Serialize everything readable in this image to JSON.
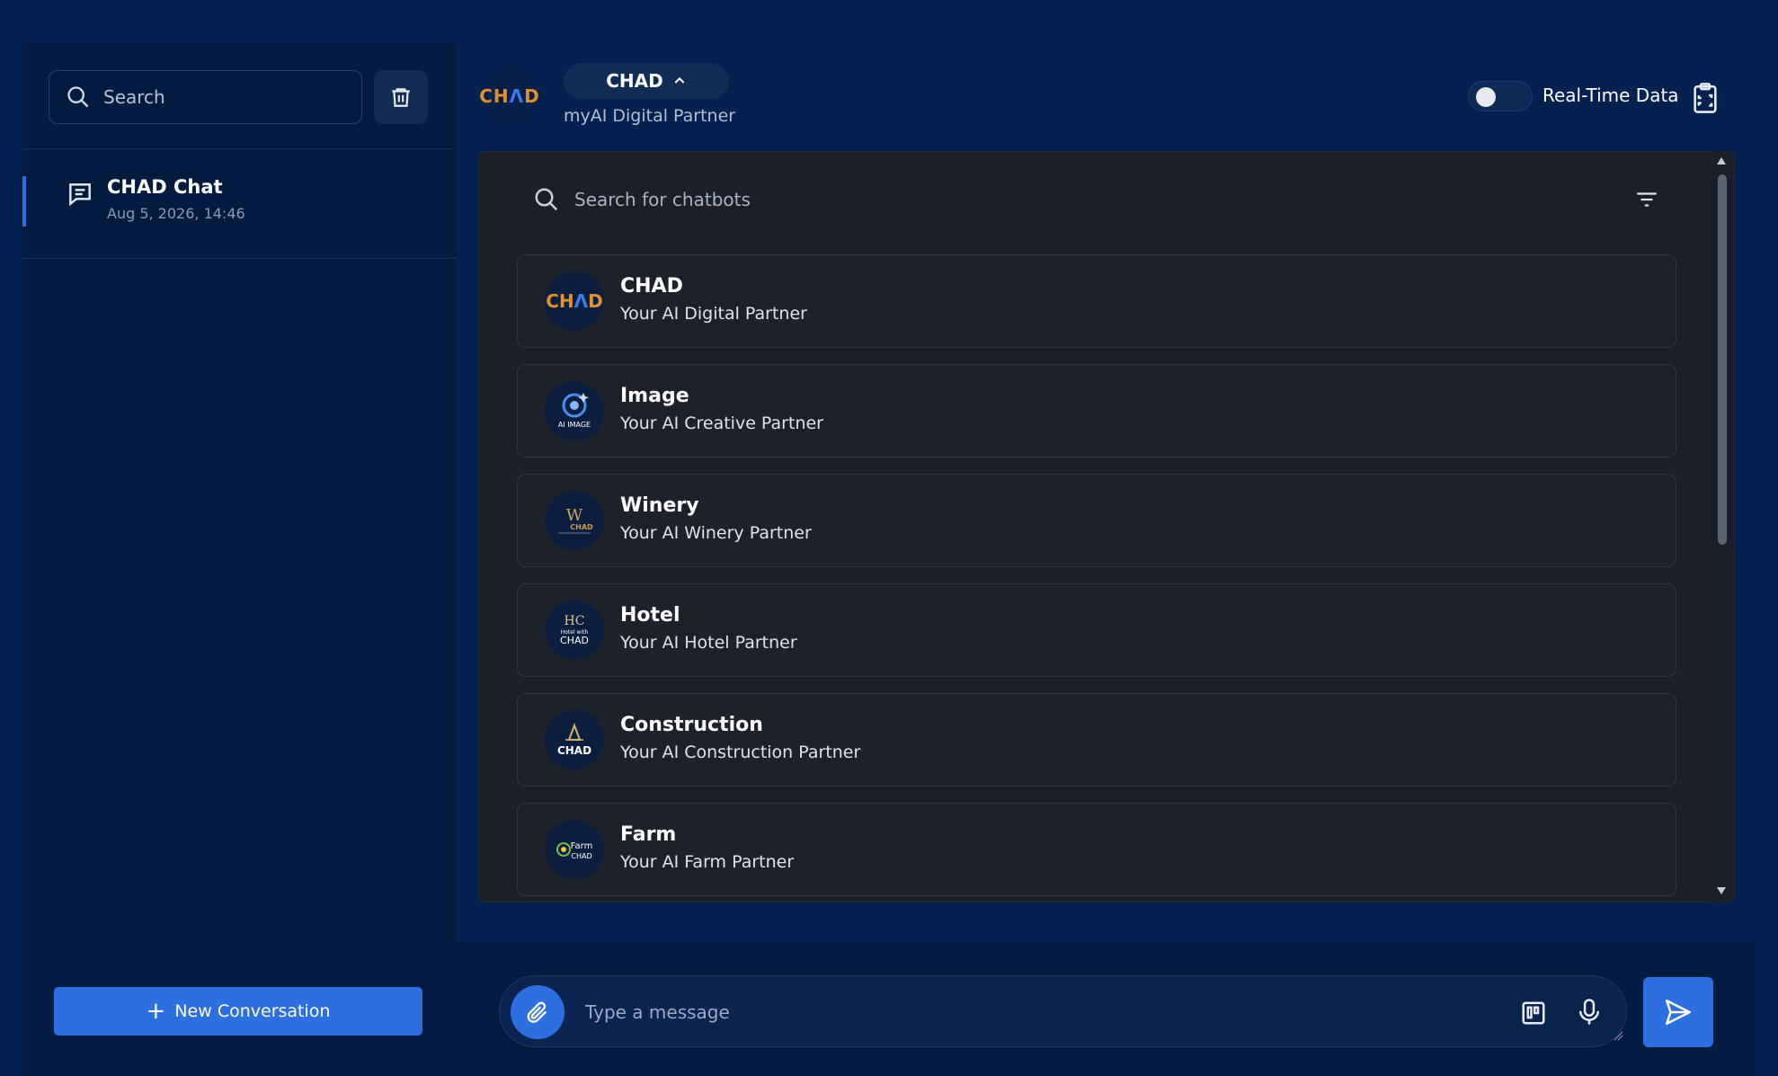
{
  "sidebar": {
    "search_placeholder": "Search",
    "conversations": [
      {
        "title": "CHAD Chat",
        "date": "Aug 5, 2026, 14:46"
      }
    ],
    "new_conversation_label": "New Conversation"
  },
  "header": {
    "logo_text": "CHAD",
    "bot_name": "CHAD",
    "bot_subtitle": "myAI Digital Partner",
    "realtime_label": "Real-Time Data",
    "realtime_enabled": false
  },
  "dropdown": {
    "search_placeholder": "Search for chatbots",
    "bots": [
      {
        "name": "CHAD",
        "desc": "Your AI Digital Partner",
        "icon": "chad-logo"
      },
      {
        "name": "Image",
        "desc": "Your AI Creative Partner",
        "icon": "ai-image-logo"
      },
      {
        "name": "Winery",
        "desc": "Your AI Winery Partner",
        "icon": "winery-logo"
      },
      {
        "name": "Hotel",
        "desc": "Your AI Hotel Partner",
        "icon": "hotel-logo"
      },
      {
        "name": "Construction",
        "desc": "Your AI Construction Partner",
        "icon": "construction-logo"
      },
      {
        "name": "Farm",
        "desc": "Your AI Farm Partner",
        "icon": "farm-logo"
      }
    ]
  },
  "composer": {
    "placeholder": "Type a message"
  },
  "colors": {
    "background": "#032150",
    "accent": "#2d6fe0",
    "panel": "#1b1f27",
    "logo_orange": "#e0902f"
  }
}
